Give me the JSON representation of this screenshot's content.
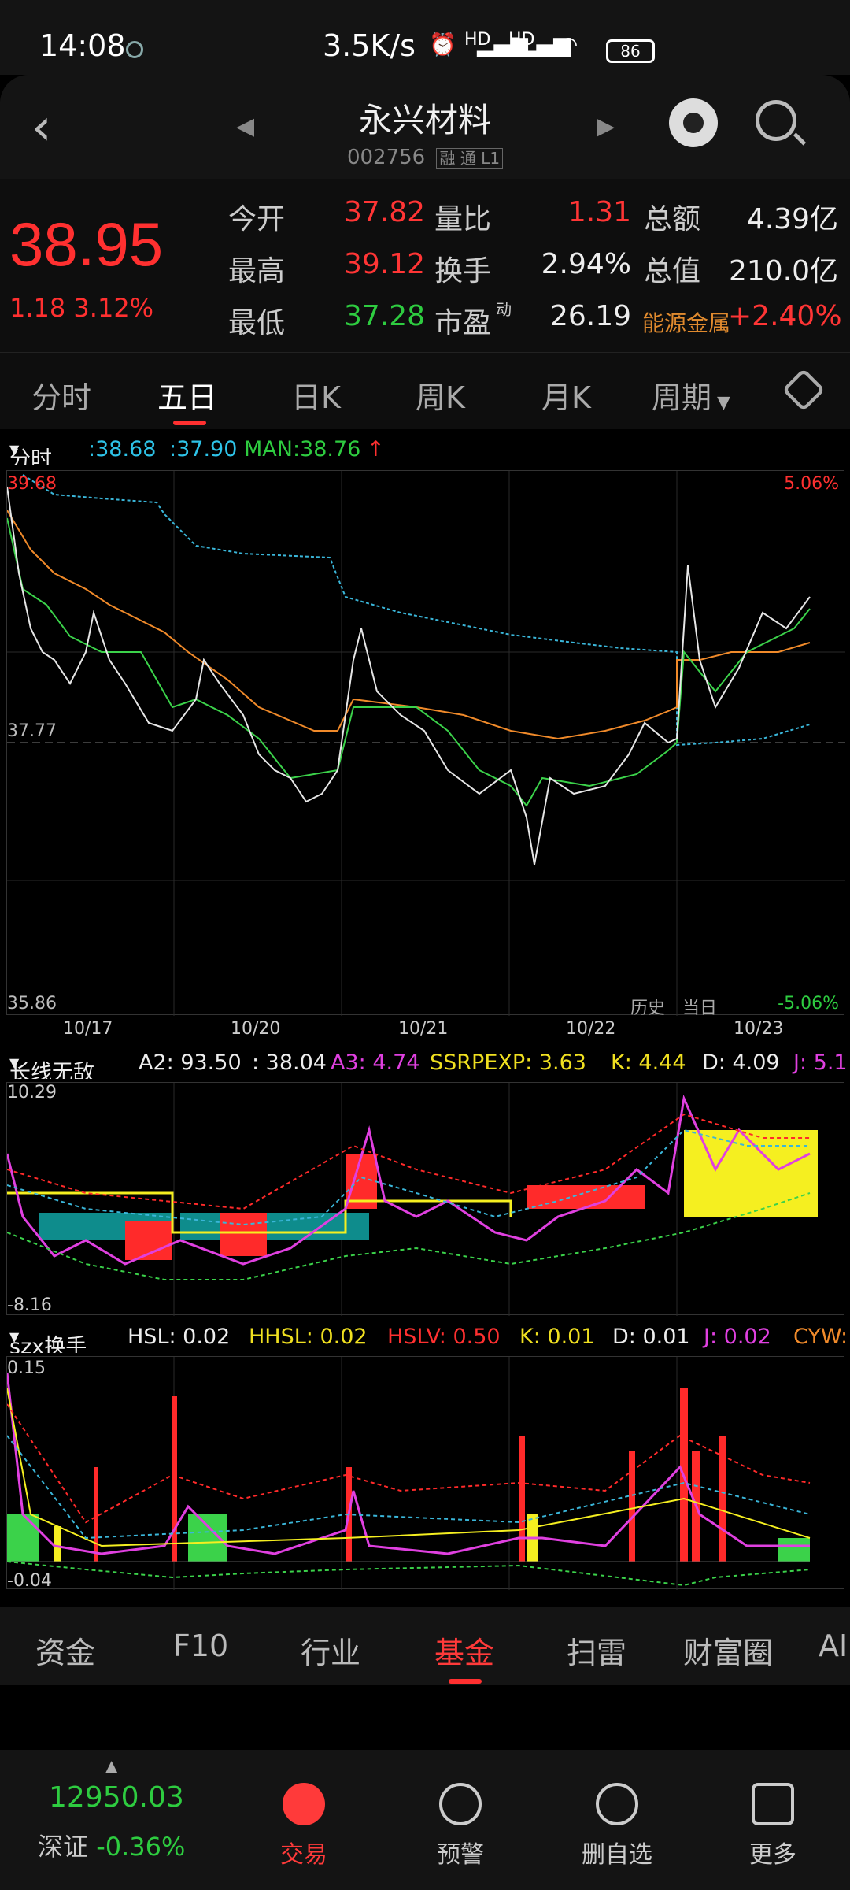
{
  "status": {
    "time": "14:08",
    "speed": "3.5K/s",
    "battery": "86",
    "hd1": "HD",
    "hd2": "HD"
  },
  "header": {
    "title": "永兴材料",
    "code": "002756",
    "badges": "融 通 L1"
  },
  "quote": {
    "price": "38.95",
    "change": "1.18  3.12%",
    "rows": [
      {
        "l1": "今开",
        "v1": "37.82",
        "l2": "量比",
        "v2": "1.31",
        "l3": "总额",
        "v3": "4.39亿"
      },
      {
        "l1": "最高",
        "v1": "39.12",
        "l2": "换手",
        "v2": "2.94%",
        "l3": "总值",
        "v3": "210.0亿"
      },
      {
        "l1": "最低",
        "v1": "37.28",
        "l2": "市盈",
        "v2": "26.19",
        "l3": "能源金属",
        "v3": "+2.40%"
      }
    ],
    "pe_sup": "动"
  },
  "tabs": [
    "分时",
    "五日",
    "日K",
    "周K",
    "月K",
    "周期"
  ],
  "main_indicator": {
    "tag": "分时",
    "v1": ":38.68",
    "v2": ":37.90",
    "man": "MAN:38.76"
  },
  "main_chart": {
    "top_left": "39.68",
    "mid_left": "37.77",
    "bottom_left": "35.86",
    "top_right": "5.06%",
    "bottom_right": "-5.06%",
    "hist": "历史",
    "today": "当日",
    "dates": [
      "10/17",
      "10/20",
      "10/21",
      "10/22",
      "10/23"
    ]
  },
  "ind2": {
    "tag": "长线无敌",
    "a2": "A2: 93.50",
    "v": ": 38.04",
    "a3": "A3: 4.74",
    "ss": "SSRPEXP: 3.63",
    "k": "K: 4.44",
    "d": "D: 4.09",
    "j": "J: 5.1",
    "top": "10.29",
    "bottom": "-8.16"
  },
  "ind3": {
    "tag": "szx换手",
    "hsl": "HSL: 0.02",
    "hhsl": "HHSL: 0.02",
    "hslv": "HSLV: 0.50",
    "k": "K: 0.01",
    "d": "D: 0.01",
    "j": "J: 0.02",
    "cyw": "CYW:",
    "top": "0.15",
    "bottom": "-0.04"
  },
  "bottom_menu": [
    "资金",
    "F10",
    "行业",
    "基金",
    "扫雷",
    "财富圈",
    "AI"
  ],
  "nav": {
    "index_value": "12950.03",
    "index_name": "深证",
    "index_change": "-0.36%",
    "items": [
      "交易",
      "预警",
      "删自选",
      "更多"
    ]
  },
  "colors": {
    "up": "#ff3030",
    "down": "#2ecc40",
    "accent": "#ff3a3a"
  }
}
